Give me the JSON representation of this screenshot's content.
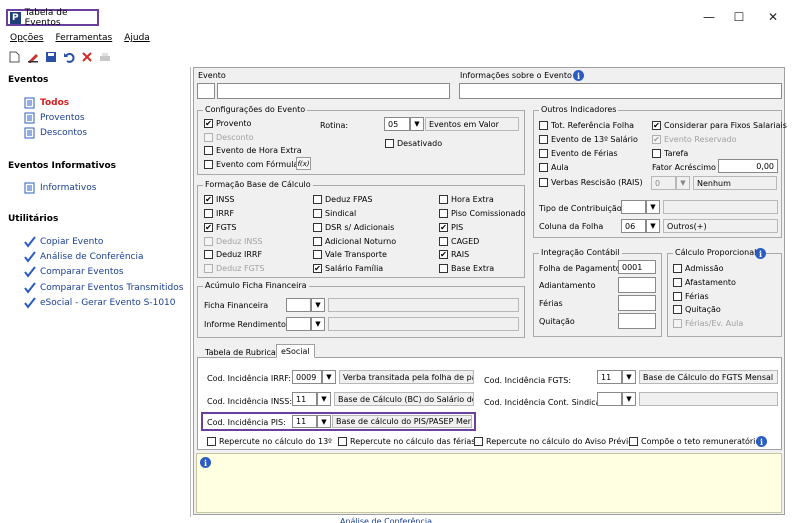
{
  "window": {
    "title": "Tabela de Eventos",
    "icon_letter": "P",
    "minimize": "—",
    "maximize": "☐",
    "close": "✕"
  },
  "menu": [
    "Opções",
    "Ferramentas",
    "Ajuda"
  ],
  "sidebar": {
    "sections": [
      {
        "title": "Eventos",
        "items": [
          "Todos",
          "Proventos",
          "Descontos"
        ]
      },
      {
        "title": "Eventos Informativos",
        "items": [
          "Informativos"
        ]
      },
      {
        "title": "Utilitários",
        "items": [
          "Copiar Evento",
          "Análise de Conferência",
          "Comparar Eventos",
          "Comparar Eventos Transmitidos",
          "eSocial - Gerar Evento S-1010"
        ]
      }
    ],
    "bottom_fragment": "Análise de Conferência"
  },
  "form": {
    "evento_label": "Evento",
    "info_label": "Informações sobre o Evento",
    "config": {
      "title": "Configurações do Evento",
      "provento": "Provento",
      "desconto": "Desconto",
      "hora_extra": "Evento de Hora Extra",
      "com_formula": "Evento com Fórmula",
      "fx": "f(x)",
      "rotina_label": "Rotina:",
      "rotina_code": "05",
      "rotina_desc": "Eventos em Valor",
      "desativado": "Desativado"
    },
    "outros": {
      "title": "Outros Indicadores",
      "tot_ref": "Tot. Referência Folha",
      "considerar": "Considerar para Fixos Salariais",
      "decimo": "Evento de 13º Salário",
      "reservado": "Evento Reservado",
      "ferias": "Evento de Férias",
      "tarefa": "Tarefa",
      "aula": "Aula",
      "fator_label": "Fator Acréscimo",
      "fator_value": "0,00",
      "verbas": "Verbas Rescisão (RAIS)",
      "verbas_code": "0",
      "verbas_desc": "Nenhum",
      "tipo_contrib_label": "Tipo de Contribuição",
      "coluna_label": "Coluna da Folha",
      "coluna_code": "06",
      "coluna_desc": "Outros(+)"
    },
    "base": {
      "title": "Formação Base de Cálculo",
      "col1": [
        "INSS",
        "IRRF",
        "FGTS",
        "Deduz INSS",
        "Deduz IRRF",
        "Deduz FGTS"
      ],
      "col2": [
        "Deduz FPAS",
        "Sindical",
        "DSR s/ Adicionais",
        "Adicional Noturno",
        "Vale Transporte",
        "Salário Família"
      ],
      "col3": [
        "Hora Extra",
        "Piso Comissionado",
        "PIS",
        "CAGED",
        "RAIS",
        "Base Extra"
      ]
    },
    "acumulo": {
      "title": "Acúmulo Ficha Financeira",
      "ficha": "Ficha Financeira",
      "informe": "Informe Rendimentos"
    },
    "integracao": {
      "title": "Integração Contábil",
      "folha": "Folha de Pagamento",
      "folha_value": "0001",
      "adiantamento": "Adiantamento",
      "ferias": "Férias",
      "quitacao": "Quitação"
    },
    "proporcional": {
      "title": "Cálculo Proporcional",
      "items": [
        "Admissão",
        "Afastamento",
        "Férias",
        "Quitação",
        "Férias/Ev. Aula"
      ]
    },
    "tabs": [
      "Tabela de Rubricas",
      "eSocial"
    ],
    "esocial": {
      "irrf_label": "Cod. Incidência IRRF:",
      "irrf_code": "0009",
      "irrf_desc": "Verba transitada pela folha de paga",
      "fgts_label": "Cod. Incidência FGTS:",
      "fgts_code": "11",
      "fgts_desc": "Base de Cálculo do FGTS Mensal",
      "inss_label": "Cod. Incidência INSS:",
      "inss_code": "11",
      "inss_desc": "Base de Cálculo (BC) do Salário de Cor",
      "sindical_label": "Cod. Incidência Cont. Sindical:",
      "pis_label": "Cod. Incidência PIS:",
      "pis_code": "11",
      "pis_desc": "Base de cálculo do PIS/PASEP Mensal",
      "rep13": "Repercute no cálculo do 13º",
      "repferias": "Repercute no cálculo das férias",
      "repaviso": "Repercute no cálculo do Aviso Prévio",
      "teto": "Compõe o teto remuneratório"
    }
  }
}
